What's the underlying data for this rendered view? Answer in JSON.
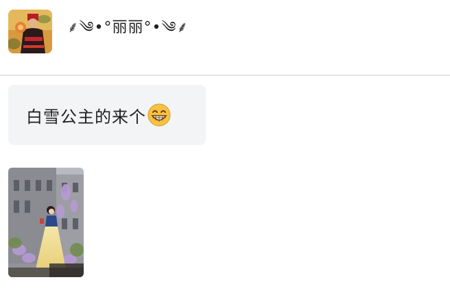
{
  "header": {
    "avatar_alt": "profile-avatar",
    "username": "⸙༄•°丽丽°•༄⸙"
  },
  "messages": [
    {
      "type": "text",
      "text": "白雪公主的来个",
      "emoji": "grinning-face-icon"
    },
    {
      "type": "image",
      "image": "snow-white-costume-photo"
    }
  ],
  "colors": {
    "bubble_bg": "#f3f4f6",
    "divider": "#e4e4e6",
    "text": "#1f1f1f"
  }
}
